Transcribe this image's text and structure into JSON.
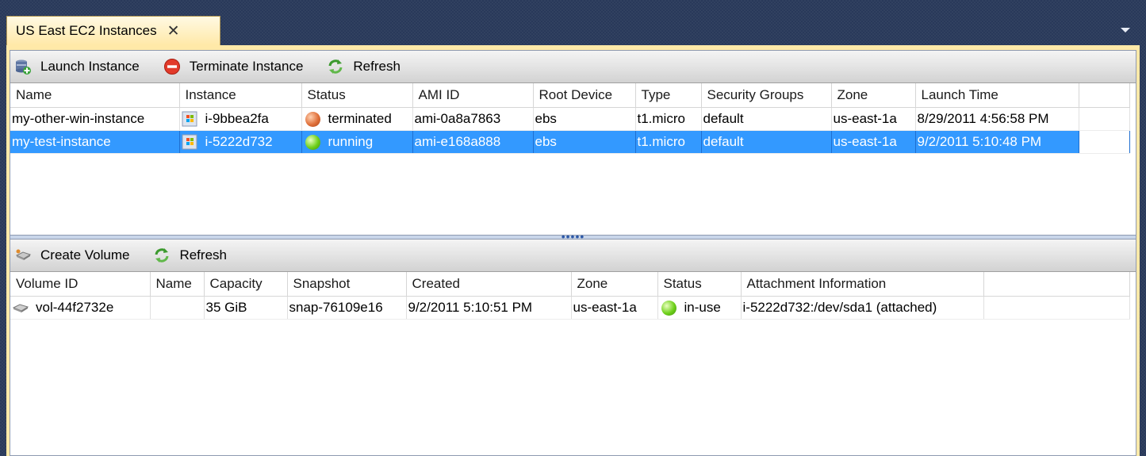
{
  "tab": {
    "title": "US East EC2 Instances",
    "close": "✕"
  },
  "instances": {
    "toolbar": {
      "launch": "Launch Instance",
      "terminate": "Terminate Instance",
      "refresh": "Refresh"
    },
    "columns": [
      "Name",
      "Instance",
      "Status",
      "AMI ID",
      "Root Device",
      "Type",
      "Security Groups",
      "Zone",
      "Launch Time"
    ],
    "rows": [
      {
        "name": "my-other-win-instance",
        "instance": "i-9bbea2fa",
        "status": "terminated",
        "status_color": "#e0703a",
        "ami": "ami-0a8a7863",
        "root": "ebs",
        "type": "t1.micro",
        "sg": "default",
        "zone": "us-east-1a",
        "launch": "8/29/2011 4:56:58 PM"
      },
      {
        "name": "my-test-instance",
        "instance": "i-5222d732",
        "status": "running",
        "status_color": "#6ed01a",
        "ami": "ami-e168a888",
        "root": "ebs",
        "type": "t1.micro",
        "sg": "default",
        "zone": "us-east-1a",
        "launch": "9/2/2011 5:10:48 PM",
        "selected": true
      }
    ]
  },
  "volumes": {
    "toolbar": {
      "create": "Create Volume",
      "refresh": "Refresh"
    },
    "columns": [
      "Volume ID",
      "Name",
      "Capacity",
      "Snapshot",
      "Created",
      "Zone",
      "Status",
      "Attachment Information"
    ],
    "rows": [
      {
        "volume_id": "vol-44f2732e",
        "name": "",
        "capacity": "35 GiB",
        "snapshot": "snap-76109e16",
        "created": "9/2/2011 5:10:51 PM",
        "zone": "us-east-1a",
        "status": "in-use",
        "status_color": "#6ed01a",
        "attachment": "i-5222d732:/dev/sda1 (attached)"
      }
    ]
  },
  "splitter": {
    "grip": "•••••"
  },
  "colors": {
    "selection": "#3399ff",
    "tab_gold": "#ffe9a8",
    "frame_navy": "#29395a"
  }
}
